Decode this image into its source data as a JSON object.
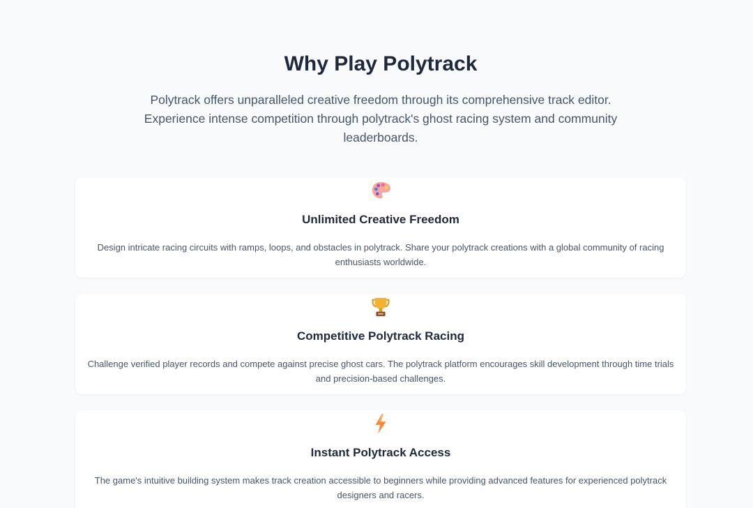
{
  "section": {
    "title": "Why Play Polytrack",
    "intro": "Polytrack offers unparalleled creative freedom through its comprehensive track editor. Experience intense competition through polytrack's ghost racing system and community leaderboards."
  },
  "features": [
    {
      "icon": "palette-icon",
      "title": "Unlimited Creative Freedom",
      "description": "Design intricate racing circuits with ramps, loops, and obstacles in polytrack. Share your polytrack creations with a global community of racing enthusiasts worldwide."
    },
    {
      "icon": "trophy-icon",
      "title": "Competitive Polytrack Racing",
      "description": "Challenge verified player records and compete against precise ghost cars. The polytrack platform encourages skill development through time trials and precision-based challenges."
    },
    {
      "icon": "lightning-icon",
      "title": "Instant Polytrack Access",
      "description": "The game's intuitive building system makes track creation accessible to beginners while providing advanced features for experienced polytrack designers and racers."
    }
  ],
  "colors": {
    "background": "#f8fafc",
    "card": "#ffffff",
    "heading": "#1e293b",
    "body_text": "#475569"
  }
}
